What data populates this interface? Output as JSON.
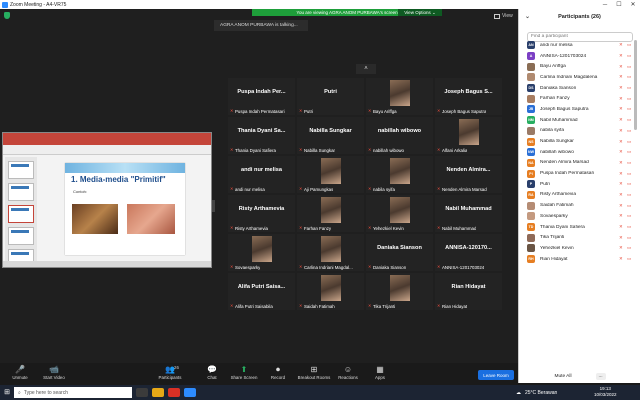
{
  "window": {
    "title": "Zoom Meeting - A4-VR75",
    "minimize": "─",
    "maximize": "☐",
    "close": "✕"
  },
  "banner": {
    "text": "You are viewing AGRA ANOM PURBAWA's screen",
    "view_options": "View Options ⌄"
  },
  "talking": "AGRA ANOM PURBAWA is talking...",
  "view_label": "View",
  "slide": {
    "title": "1. Media-media \"Primitif\"",
    "sub": "Contoh:"
  },
  "tiles": [
    {
      "name": "Puspa Indah Per...",
      "label": "Puspa Indah Permatasari",
      "photo": false
    },
    {
      "name": "Putri",
      "label": "Putri",
      "photo": false
    },
    {
      "name": "",
      "label": "Bayu Ariffga",
      "photo": true
    },
    {
      "name": "Joseph Bagus S...",
      "label": "Joseph Bagus Saputra",
      "photo": false
    },
    {
      "name": "Thania Dyani Sa...",
      "label": "Thania Dyani Safiera",
      "photo": false
    },
    {
      "name": "Nabilla Sungkar",
      "label": "Nabilla Sungkar",
      "photo": false
    },
    {
      "name": "nabillah wibowo",
      "label": "nabillah wibowo",
      "photo": false
    },
    {
      "name": "",
      "label": "Alfani Arkalia",
      "photo": true
    },
    {
      "name": "andi nur melisa",
      "label": "andi nur melisa",
      "photo": false
    },
    {
      "name": "",
      "label": "Aji Pamungkas",
      "photo": true
    },
    {
      "name": "",
      "label": "nabila syifa",
      "photo": true
    },
    {
      "name": "Nenden Almira...",
      "label": "Nenden Almira Marsad",
      "photo": false
    },
    {
      "name": "Risty Arthamevia",
      "label": "Risty Arthamevia",
      "photo": false
    },
    {
      "name": "",
      "label": "Farhan Fanzy",
      "photo": true
    },
    {
      "name": "",
      "label": "Yehezkiel Kevin",
      "photo": true
    },
    {
      "name": "Nabil Muhammad",
      "label": "Nabil Muhammad",
      "photo": false
    },
    {
      "name": "",
      "label": "Sovaesparky",
      "photo": true
    },
    {
      "name": "",
      "label": "Carlina Indriani Magdal...",
      "photo": true
    },
    {
      "name": "Daniaka Sianson",
      "label": "Daniaka Sianson",
      "photo": false
    },
    {
      "name": "ANNISA-120170...",
      "label": "ANNISA-1201703024",
      "photo": false
    },
    {
      "name": "Alifa Putri Saisa...",
      "label": "Alifa Putri Saisabila",
      "photo": false
    },
    {
      "name": "",
      "label": "Saidah Fatimah",
      "photo": true
    },
    {
      "name": "",
      "label": "Tika Trijanti",
      "photo": true
    },
    {
      "name": "Rian Hidayat",
      "label": "Rian Hidayat",
      "photo": false
    }
  ],
  "unassigned": "1 unassigned participant",
  "panel": {
    "title": "Participants (26)",
    "search_placeholder": "Find a participant",
    "participants": [
      {
        "initials": "AN",
        "color": "#2a3f6b",
        "name": "andi nur melisa"
      },
      {
        "initials": "A",
        "color": "#7b3fc4",
        "name": "ANNISA-1201703024"
      },
      {
        "initials": "",
        "color": "#8a6d55",
        "name": "Bayu Ariffga"
      },
      {
        "initials": "",
        "color": "#b08a70",
        "name": "Carlina Indriani Magdalena"
      },
      {
        "initials": "DS",
        "color": "#2a3f6b",
        "name": "Daniaka Sianson"
      },
      {
        "initials": "",
        "color": "#a87d60",
        "name": "Farhan Fanzy"
      },
      {
        "initials": "JB",
        "color": "#2a6fd6",
        "name": "Joseph Bagus Saputra"
      },
      {
        "initials": "NM",
        "color": "#27ae60",
        "name": "Nabil Muhammad"
      },
      {
        "initials": "",
        "color": "#9a7a66",
        "name": "nabila syifa"
      },
      {
        "initials": "NS",
        "color": "#e67e22",
        "name": "Nabilla Sungkar"
      },
      {
        "initials": "NW",
        "color": "#2a6fd6",
        "name": "nabillah wibowo"
      },
      {
        "initials": "NA",
        "color": "#e67e22",
        "name": "Nenden Almira Marsad"
      },
      {
        "initials": "PI",
        "color": "#e67e22",
        "name": "Puspa Indah Permatasari"
      },
      {
        "initials": "P",
        "color": "#2a3f6b",
        "name": "Putri"
      },
      {
        "initials": "RA",
        "color": "#e67e22",
        "name": "Risty Arthamevia"
      },
      {
        "initials": "",
        "color": "#b58c74",
        "name": "Saidah Fatimah"
      },
      {
        "initials": "",
        "color": "#c49a80",
        "name": "Sovaesparky"
      },
      {
        "initials": "TD",
        "color": "#e67e22",
        "name": "Thania Dyani Safiera"
      },
      {
        "initials": "",
        "color": "#8f6a58",
        "name": "Tika Trijanti"
      },
      {
        "initials": "",
        "color": "#6a5544",
        "name": "Yehezkiel Kevin"
      },
      {
        "initials": "RH",
        "color": "#e67e22",
        "name": "Rian Hidayat"
      }
    ],
    "mute_all": "Mute All",
    "more": "..."
  },
  "toolbar": {
    "unmute": "Unmute",
    "start_video": "Start Video",
    "participants": "Participants",
    "participants_count": "26",
    "chat": "Chat",
    "share_screen": "Share Screen",
    "record": "Record",
    "breakout_rooms": "Breakout Rooms",
    "reactions": "Reactions",
    "apps": "Apps",
    "leave_room": "Leave Room"
  },
  "taskbar": {
    "search_placeholder": "Type here to search",
    "weather": "25°C Berawan",
    "time": "19:13",
    "date": "10/03/2022"
  }
}
